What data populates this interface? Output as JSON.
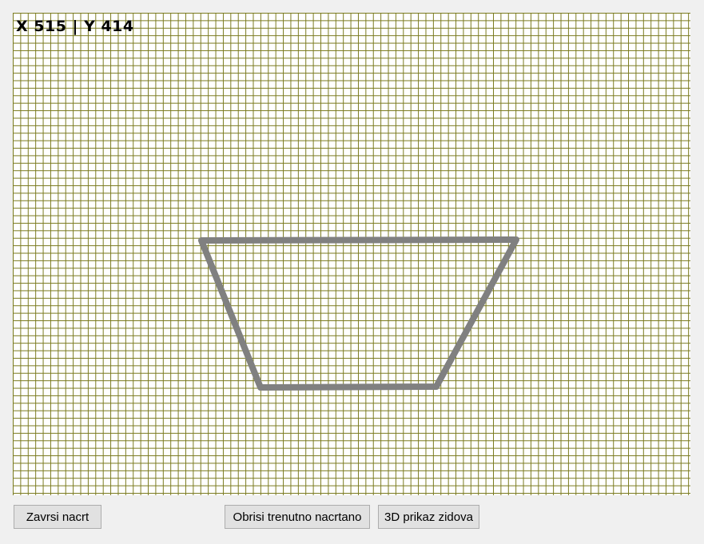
{
  "canvas": {
    "coord_readout": "X 515 | Y 414",
    "grid_color": "#7a7a1e",
    "shape_color": "#808080"
  },
  "buttons": {
    "finish_label": "Zavrsi nacrt",
    "erase_label": "Obrisi trenutno nacrtano",
    "view3d_label": "3D prikaz zidova"
  }
}
